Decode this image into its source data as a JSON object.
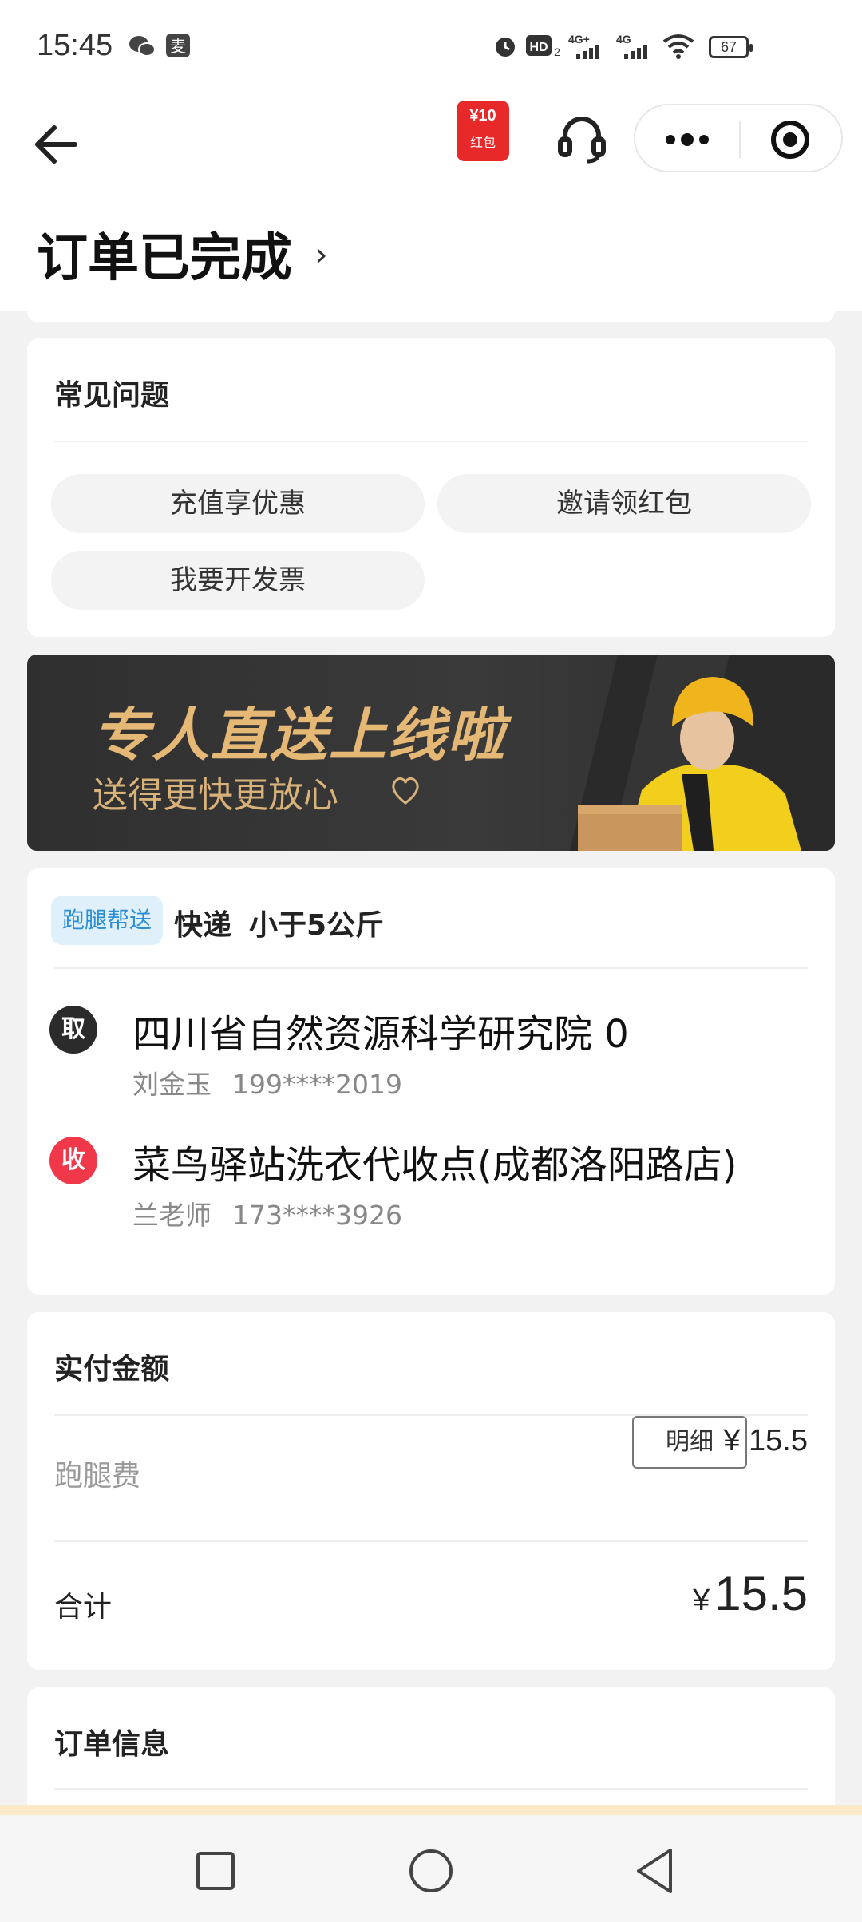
{
  "status_bar": {
    "time": "15:45",
    "battery": "67",
    "icons": [
      "wechat-icon",
      "app-icon",
      "alarm-icon",
      "hd-icon",
      "signal-4g-icon",
      "signal-4g-icon",
      "wifi-icon",
      "battery-icon"
    ]
  },
  "nav": {
    "redpacket_amount": "¥10",
    "redpacket_label": "红包"
  },
  "header": {
    "title": "订单已完成",
    "chevron": "›"
  },
  "faq": {
    "title": "常见问题",
    "items": [
      "充值享优惠",
      "邀请领红包",
      "我要开发票"
    ]
  },
  "banner": {
    "title": "专人直送上线啦",
    "subtitle": "送得更快更放心"
  },
  "route": {
    "tag": "跑腿帮送",
    "type": "快递",
    "weight": "小于5公斤",
    "pickup": {
      "badge": "取",
      "address": "四川省自然资源科学研究院 0",
      "name": "刘金玉",
      "phone": "199****2019"
    },
    "delivery": {
      "badge": "收",
      "address": "菜鸟驿站洗衣代收点(成都洛阳路店)",
      "name": "兰老师",
      "phone": "173****3926"
    }
  },
  "payment": {
    "title": "实付金额",
    "fee_label": "跑腿费",
    "detail_button": "明细",
    "fee_value": "¥ 15.5",
    "total_label": "合计",
    "total_currency": "¥",
    "total_value": "15.5"
  },
  "order_info": {
    "title": "订单信息"
  },
  "colors": {
    "pickup_dot": "#2b2b2b",
    "delivery_dot": "#f0384a",
    "tag_bg": "#dff0fb",
    "tag_text": "#2a8ed6",
    "banner_text": "#e5b876",
    "redpacket": "#e8292a"
  }
}
